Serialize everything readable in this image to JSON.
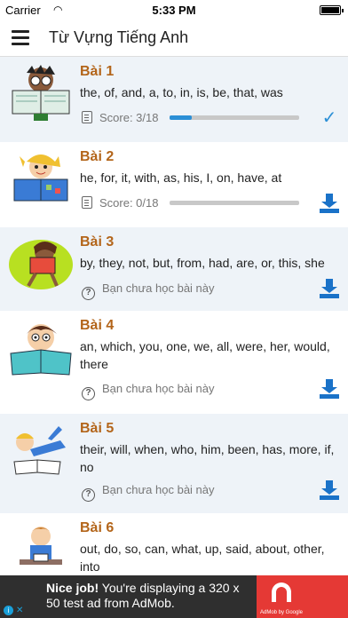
{
  "status_bar": {
    "carrier": "Carrier",
    "time": "5:33 PM"
  },
  "app_bar": {
    "title": "Từ Vựng Tiếng Anh"
  },
  "lessons": [
    {
      "title": "Bài 1",
      "words": "the, of, and, a, to, in, is, be, that, was",
      "status": "Score: 3/18",
      "progress": 0.17,
      "action": "completed-check"
    },
    {
      "title": "Bài 2",
      "words": "he, for, it, with, as, his, I, on, have, at",
      "status": "Score: 0/18",
      "progress": 0.0,
      "action": "download"
    },
    {
      "title": "Bài 3",
      "words": "by, they, not, but, from, had, are, or, this, she",
      "status": "Bạn chưa học bài này",
      "action": "download"
    },
    {
      "title": "Bài 4",
      "words": "an, which, you, one, we, all, were, her, would, there",
      "status": "Bạn chưa học bài này",
      "action": "download"
    },
    {
      "title": "Bài 5",
      "words": "their, will, when, who, him, been, has, more, if, no",
      "status": "Bạn chưa học bài này",
      "action": "download"
    },
    {
      "title": "Bài 6",
      "words": "out, do, so, can, what, up, said, about, other, into"
    }
  ],
  "ad": {
    "headline": "Nice job!",
    "body": "You're displaying a 320 x 50 test ad from AdMob.",
    "logo_caption": "AdMob by Google"
  },
  "colors": {
    "accent": "#2b8fd6",
    "lesson_title": "#b3651a",
    "download": "#1a72c8",
    "ad_red": "#e53935"
  }
}
